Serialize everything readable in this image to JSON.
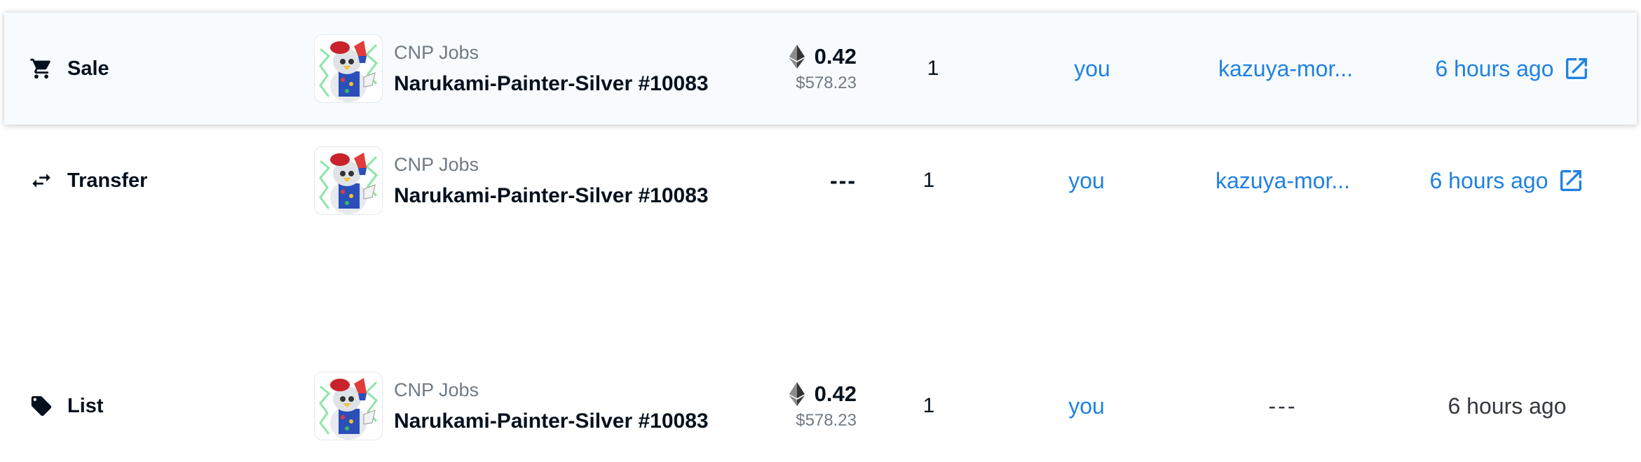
{
  "rows": [
    {
      "event": "Sale",
      "event_icon": "cart-icon",
      "collection": "CNP Jobs",
      "item_name": "Narukami-Painter-Silver #10083",
      "price_eth": "0.42",
      "price_usd": "$578.23",
      "quantity": "1",
      "from": "you",
      "to": "kazuya-mor...",
      "time": "6 hours ago",
      "time_link": true
    },
    {
      "event": "Transfer",
      "event_icon": "transfer-arrows-icon",
      "collection": "CNP Jobs",
      "item_name": "Narukami-Painter-Silver #10083",
      "price_placeholder": "---",
      "quantity": "1",
      "from": "you",
      "to": "kazuya-mor...",
      "time": "6 hours ago",
      "time_link": true
    },
    {
      "event": "List",
      "event_icon": "tag-icon",
      "collection": "CNP Jobs",
      "item_name": "Narukami-Painter-Silver #10083",
      "price_eth": "0.42",
      "price_usd": "$578.23",
      "quantity": "1",
      "from": "you",
      "to": "---",
      "time": "6 hours ago",
      "time_link": false
    }
  ],
  "colors": {
    "link": "#2081e2",
    "muted": "#707a83",
    "text": "#04111d",
    "highlight_bg": "#f7fbfe"
  }
}
